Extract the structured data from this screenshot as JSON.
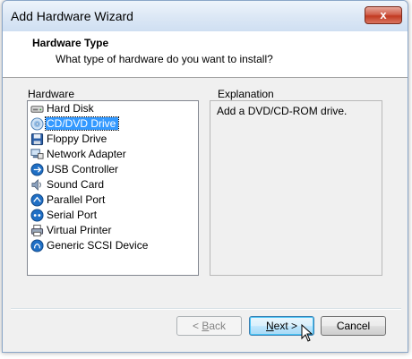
{
  "window": {
    "title": "Add Hardware Wizard",
    "close_glyph": "x"
  },
  "header": {
    "title": "Hardware Type",
    "subtitle": "What type of hardware do you want to install?"
  },
  "hardware": {
    "label": "Hardware",
    "items": [
      {
        "label": "Hard Disk",
        "icon": "hard-disk-icon"
      },
      {
        "label": "CD/DVD Drive",
        "icon": "cd-dvd-icon",
        "selected": true
      },
      {
        "label": "Floppy Drive",
        "icon": "floppy-icon"
      },
      {
        "label": "Network Adapter",
        "icon": "network-adapter-icon"
      },
      {
        "label": "USB Controller",
        "icon": "usb-icon"
      },
      {
        "label": "Sound Card",
        "icon": "sound-card-icon"
      },
      {
        "label": "Parallel Port",
        "icon": "parallel-port-icon"
      },
      {
        "label": "Serial Port",
        "icon": "serial-port-icon"
      },
      {
        "label": "Virtual Printer",
        "icon": "printer-icon"
      },
      {
        "label": "Generic SCSI Device",
        "icon": "scsi-icon"
      }
    ]
  },
  "explanation": {
    "label": "Explanation",
    "text": "Add a DVD/CD-ROM drive."
  },
  "buttons": {
    "back": {
      "prefix": "< ",
      "accel": "B",
      "rest": "ack",
      "enabled": false
    },
    "next": {
      "accel": "N",
      "rest": "ext >",
      "enabled": true
    },
    "cancel": {
      "label": "Cancel"
    }
  },
  "colors": {
    "selection": "#3399ff",
    "accent_blue": "#1f6fc5",
    "close_red": "#c23b22"
  }
}
